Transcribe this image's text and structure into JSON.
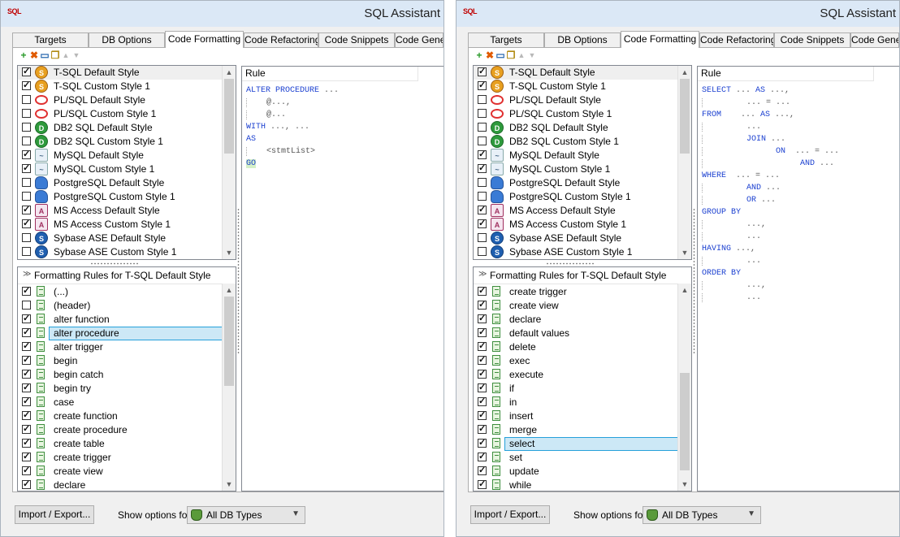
{
  "app": {
    "title": "SQL Assistant",
    "icon_text": "SQL"
  },
  "tabs": [
    "Targets",
    "DB Options",
    "Code Formatting",
    "Code Refactoring",
    "Code Snippets",
    "Code Gene"
  ],
  "toolbar": {
    "icons": [
      "add-icon",
      "delete-icon",
      "properties-icon",
      "copy-icon",
      "move-up-icon",
      "move-down-icon"
    ]
  },
  "styles": [
    {
      "label": "T-SQL Default Style",
      "checked": true,
      "icon": "tsql-icon"
    },
    {
      "label": "T-SQL Custom Style 1",
      "checked": true,
      "icon": "tsql-icon"
    },
    {
      "label": "PL/SQL Default Style",
      "checked": false,
      "icon": "oracle-icon"
    },
    {
      "label": "PL/SQL Custom Style 1",
      "checked": false,
      "icon": "oracle-icon"
    },
    {
      "label": "DB2 SQL Default Style",
      "checked": false,
      "icon": "db2-icon"
    },
    {
      "label": "DB2 SQL Custom Style 1",
      "checked": false,
      "icon": "db2-icon"
    },
    {
      "label": "MySQL Default Style",
      "checked": true,
      "icon": "mysql-icon"
    },
    {
      "label": "MySQL Custom Style 1",
      "checked": true,
      "icon": "mysql-icon"
    },
    {
      "label": "PostgreSQL Default Style",
      "checked": false,
      "icon": "postgresql-icon"
    },
    {
      "label": "PostgreSQL Custom Style 1",
      "checked": false,
      "icon": "postgresql-icon"
    },
    {
      "label": "MS Access Default Style",
      "checked": true,
      "icon": "msaccess-icon"
    },
    {
      "label": "MS Access Custom Style 1",
      "checked": true,
      "icon": "msaccess-icon"
    },
    {
      "label": "Sybase ASE Default Style",
      "checked": false,
      "icon": "sybase-icon"
    },
    {
      "label": "Sybase ASE Custom Style 1",
      "checked": false,
      "icon": "sybase-icon"
    }
  ],
  "rules_header": "Formatting Rules for T-SQL Default Style",
  "rule_panel_header": "Rule",
  "left": {
    "rules": [
      {
        "label": "(...)",
        "checked": true
      },
      {
        "label": "(header)",
        "checked": false
      },
      {
        "label": "alter function",
        "checked": true
      },
      {
        "label": "alter procedure",
        "checked": true,
        "selected": true
      },
      {
        "label": "alter trigger",
        "checked": true
      },
      {
        "label": "begin",
        "checked": true
      },
      {
        "label": "begin catch",
        "checked": true
      },
      {
        "label": "begin try",
        "checked": true
      },
      {
        "label": "case",
        "checked": true
      },
      {
        "label": "create function",
        "checked": true
      },
      {
        "label": "create procedure",
        "checked": true
      },
      {
        "label": "create table",
        "checked": true
      },
      {
        "label": "create trigger",
        "checked": true
      },
      {
        "label": "create view",
        "checked": true
      },
      {
        "label": "declare",
        "checked": true
      }
    ],
    "code": [
      [
        [
          "kw",
          "ALTER PROCEDURE"
        ],
        [
          "t",
          " ..."
        ]
      ],
      [
        [
          "g",
          "    "
        ],
        [
          "t",
          "@..., "
        ]
      ],
      [
        [
          "g",
          "    "
        ],
        [
          "t",
          "@..."
        ]
      ],
      [
        [
          "kw",
          "WITH"
        ],
        [
          "t",
          " ..., ..."
        ]
      ],
      [
        [
          "kw",
          "AS"
        ]
      ],
      [
        [
          "g",
          "    "
        ],
        [
          "t",
          "<stmtList>"
        ]
      ],
      [
        [
          "go",
          "GO"
        ]
      ]
    ]
  },
  "right": {
    "rules": [
      {
        "label": "create trigger",
        "checked": true
      },
      {
        "label": "create view",
        "checked": true
      },
      {
        "label": "declare",
        "checked": true
      },
      {
        "label": "default values",
        "checked": true
      },
      {
        "label": "delete",
        "checked": true
      },
      {
        "label": "exec",
        "checked": true
      },
      {
        "label": "execute",
        "checked": true
      },
      {
        "label": "if",
        "checked": true
      },
      {
        "label": "in",
        "checked": true
      },
      {
        "label": "insert",
        "checked": true
      },
      {
        "label": "merge",
        "checked": true
      },
      {
        "label": "select",
        "checked": true,
        "selected": true
      },
      {
        "label": "set",
        "checked": true
      },
      {
        "label": "update",
        "checked": true
      },
      {
        "label": "while",
        "checked": true
      }
    ],
    "code": [
      [
        [
          "kw",
          "SELECT"
        ],
        [
          "t",
          " ... "
        ],
        [
          "kw",
          "AS"
        ],
        [
          "t",
          " ...,"
        ]
      ],
      [
        [
          "g",
          "         "
        ],
        [
          "t",
          "... = ..."
        ]
      ],
      [
        [
          "kw",
          "FROM"
        ],
        [
          "t",
          "    ... "
        ],
        [
          "kw",
          "AS"
        ],
        [
          "t",
          " ...,"
        ]
      ],
      [
        [
          "g",
          "         "
        ],
        [
          "t",
          "..."
        ]
      ],
      [
        [
          "g",
          "         "
        ],
        [
          "kw",
          "JOIN"
        ],
        [
          "t",
          " ..."
        ]
      ],
      [
        [
          "g",
          "               "
        ],
        [
          "kw",
          "ON"
        ],
        [
          "t",
          "  ... = ..."
        ]
      ],
      [
        [
          "g",
          "                    "
        ],
        [
          "kw",
          "AND"
        ],
        [
          "t",
          " ..."
        ]
      ],
      [
        [
          "kw",
          "WHERE"
        ],
        [
          "t",
          "  ... = ..."
        ]
      ],
      [
        [
          "g",
          "         "
        ],
        [
          "kw",
          "AND"
        ],
        [
          "t",
          " ..."
        ]
      ],
      [
        [
          "g",
          "         "
        ],
        [
          "kw",
          "OR"
        ],
        [
          "t",
          " ..."
        ]
      ],
      [
        [
          "kw",
          "GROUP BY"
        ]
      ],
      [
        [
          "g",
          "         "
        ],
        [
          "t",
          "...,"
        ]
      ],
      [
        [
          "g",
          "         "
        ],
        [
          "t",
          "..."
        ]
      ],
      [
        [
          "kw",
          "HAVING"
        ],
        [
          "t",
          " ...,"
        ]
      ],
      [
        [
          "g",
          "         "
        ],
        [
          "t",
          "..."
        ]
      ],
      [
        [
          "kw",
          "ORDER BY"
        ]
      ],
      [
        [
          "g",
          "         "
        ],
        [
          "t",
          "...,"
        ]
      ],
      [
        [
          "g",
          "         "
        ],
        [
          "t",
          "..."
        ]
      ]
    ]
  },
  "footer": {
    "import_export_label": "Import / Export...",
    "show_options_label": "Show options for:",
    "db_types_value": "All DB Types"
  }
}
